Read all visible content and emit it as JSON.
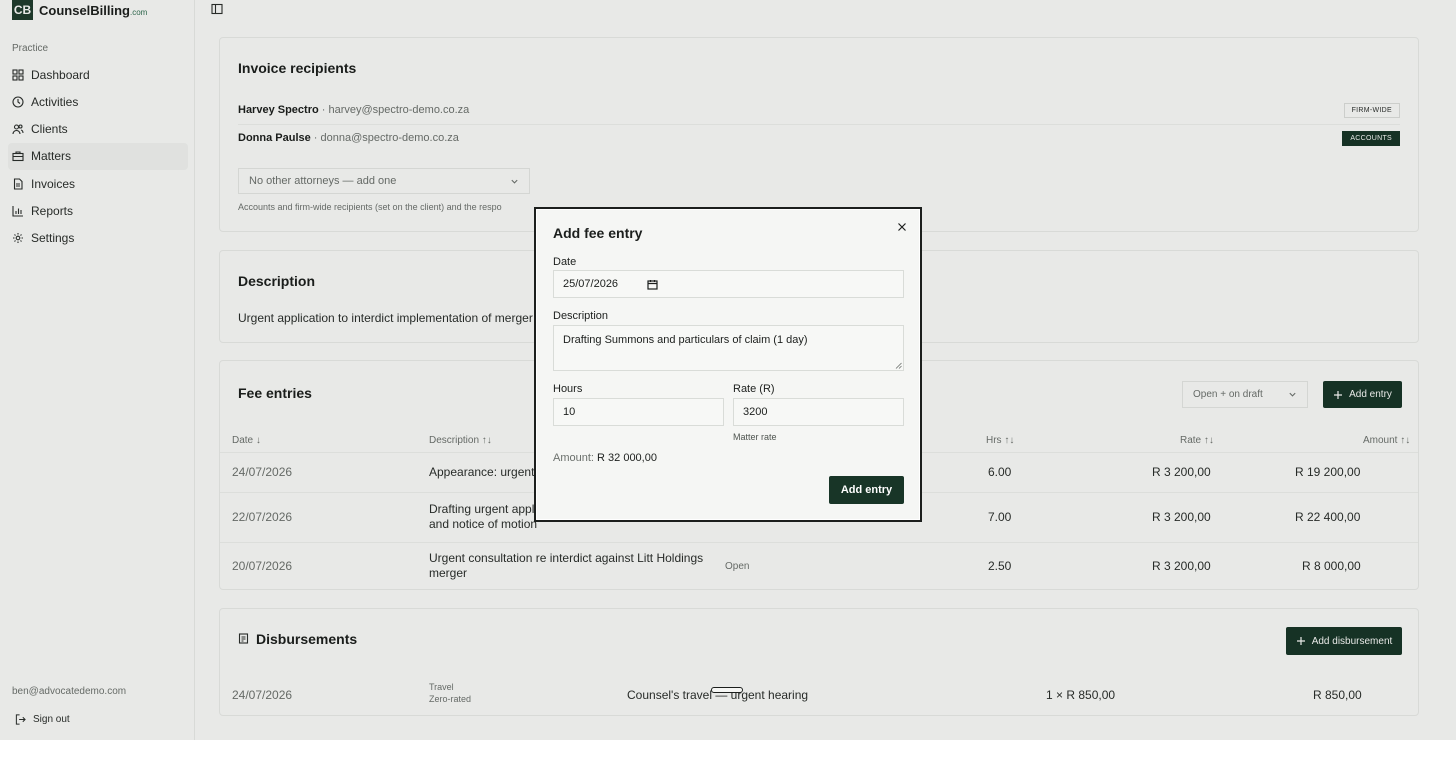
{
  "brand": {
    "logo_mark": "CB",
    "name": "CounselBilling",
    "domain": ".com"
  },
  "sidebar": {
    "section": "Practice",
    "items": [
      {
        "label": "Dashboard",
        "icon": "grid-icon"
      },
      {
        "label": "Activities",
        "icon": "clock-icon"
      },
      {
        "label": "Clients",
        "icon": "users-icon"
      },
      {
        "label": "Matters",
        "icon": "briefcase-icon",
        "active": true
      },
      {
        "label": "Invoices",
        "icon": "file-icon"
      },
      {
        "label": "Reports",
        "icon": "bar-chart-icon"
      },
      {
        "label": "Settings",
        "icon": "gear-icon"
      }
    ],
    "user_email": "ben@advocatedemo.com",
    "sign_out": "Sign out"
  },
  "recipients": {
    "title": "Invoice recipients",
    "rows": [
      {
        "name": "Harvey Spectro",
        "sep": " · ",
        "email": "harvey@spectro-demo.co.za",
        "tag": "FIRM-WIDE"
      },
      {
        "name": "Donna Paulse",
        "sep": " · ",
        "email": "donna@spectro-demo.co.za",
        "tag": "ACCOUNTS"
      }
    ],
    "select_value": "No other attorneys — add one",
    "hint": "Accounts and firm-wide recipients (set on the client) and the respo"
  },
  "description": {
    "title": "Description",
    "text": "Urgent application to interdict implementation of merger pe"
  },
  "fees": {
    "title": "Fee entries",
    "filter": "Open + on draft",
    "add_button": "Add entry",
    "headers": {
      "date": "Date ↓",
      "description": "Description ↑↓",
      "hrs": "Hrs ↑↓",
      "rate": "Rate ↑↓",
      "amount": "Amount ↑↓"
    },
    "rows": [
      {
        "date": "24/07/2026",
        "desc1": "Appearance: urgent a",
        "desc2": "",
        "status": "",
        "hrs": "6.00",
        "rate": "R 3 200,00",
        "amount": "R 19 200,00"
      },
      {
        "date": "22/07/2026",
        "desc1": "Drafting urgent applic",
        "desc2": "and notice of motion",
        "status": "",
        "hrs": "7.00",
        "rate": "R 3 200,00",
        "amount": "R 22 400,00"
      },
      {
        "date": "20/07/2026",
        "desc1": "Urgent consultation re interdict against Litt Holdings",
        "desc2": "merger",
        "status": "Open",
        "hrs": "2.50",
        "rate": "R 3 200,00",
        "amount": "R 8 000,00"
      }
    ]
  },
  "disbursements": {
    "title": "Disbursements",
    "add_button": "Add disbursement",
    "rows": [
      {
        "date": "24/07/2026",
        "category": "Travel",
        "vat": "Zero-rated",
        "description": "Counsel's travel — urgent hearing",
        "qty": "1 × R 850,00",
        "amount": "R 850,00"
      }
    ]
  },
  "modal": {
    "title": "Add fee entry",
    "date_label": "Date",
    "date_value": "25/07/2026",
    "description_label": "Description",
    "description_value": "Drafting Summons and particulars of claim (1 day)",
    "hours_label": "Hours",
    "hours_value": "10",
    "rate_label": "Rate (R)",
    "rate_value": "3200",
    "rate_hint": "Matter rate",
    "amount_label": "Amount:",
    "amount_value": "R 32 000,00",
    "submit": "Add entry"
  }
}
